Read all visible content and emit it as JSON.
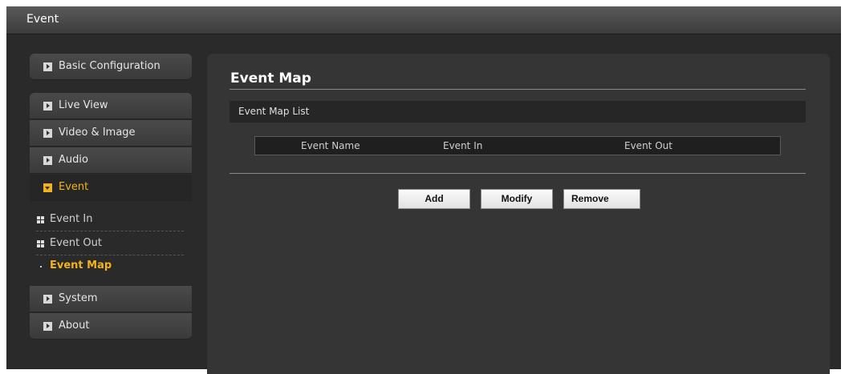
{
  "window": {
    "title": "Event"
  },
  "sidebar": {
    "items": [
      {
        "label": "Basic Configuration"
      },
      {
        "label": "Live View"
      },
      {
        "label": "Video & Image"
      },
      {
        "label": "Audio"
      },
      {
        "label": "Event"
      },
      {
        "label": "System"
      },
      {
        "label": "About"
      }
    ],
    "sub_items": [
      {
        "label": "Event In"
      },
      {
        "label": "Event Out"
      },
      {
        "label": "Event Map"
      }
    ]
  },
  "main": {
    "title": "Event Map",
    "section": "Event Map List",
    "columns": [
      "Event Name",
      "Event In",
      "Event Out"
    ],
    "buttons": {
      "add": "Add",
      "modify": "Modify",
      "remove": "Remove"
    }
  },
  "colors": {
    "accent": "#f2b21b",
    "background": "#2a2a2a",
    "panel": "#353535"
  }
}
